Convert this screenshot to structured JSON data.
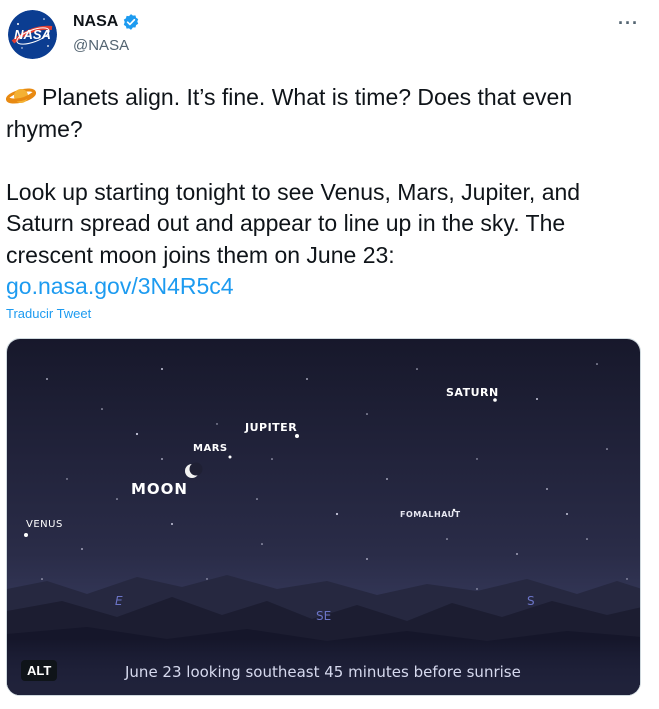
{
  "author": {
    "name": "NASA",
    "handle": "@NASA",
    "avatar_text": "NASA",
    "verified_icon": "verified-badge-icon"
  },
  "more_menu": "···",
  "tweet": {
    "paragraph1": "Planets align. It’s fine. What is time? Does that even rhyme?",
    "paragraph2": "Look up starting tonight to see Venus, Mars, Jupiter, and Saturn spread out and appear to line up in the sky. The crescent moon joins them on June 23:",
    "link": "go.nasa.gov/3N4R5c4",
    "emoji_icon": "ringed-planet-icon"
  },
  "translate_label": "Traducir Tweet",
  "media": {
    "labels": {
      "saturn": "SATURN",
      "jupiter": "JUPITER",
      "mars": "MARS",
      "moon": "MOON",
      "venus": "VENUS",
      "fomalhaut": "FOMALHAUT",
      "east": "E",
      "southeast": "SE",
      "south": "S"
    },
    "alt_badge": "ALT",
    "caption": "June 23 looking southeast 45 minutes before sunrise"
  },
  "colors": {
    "link": "#1d9bf0",
    "verified": "#1d9bf0",
    "sky_top": "#1a1b2e",
    "sky_bottom": "#3b3f63",
    "text": "#0f1419",
    "secondary": "#536471"
  }
}
